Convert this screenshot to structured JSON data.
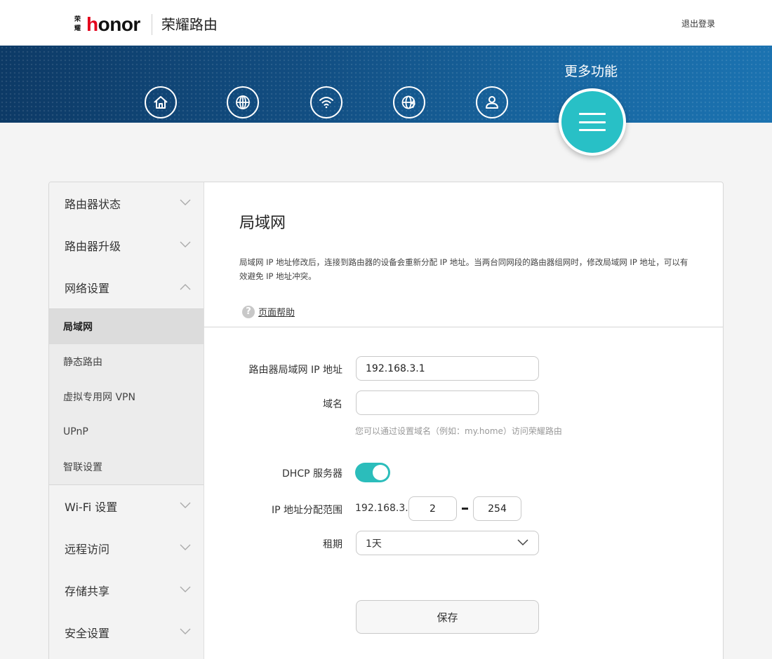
{
  "header": {
    "logo_small_top": "荣",
    "logo_small_bottom": "耀",
    "logo_brand_h": "h",
    "logo_brand_rest": "onor",
    "product_title": "荣耀路由",
    "logout_label": "退出登录"
  },
  "banner": {
    "nav_icons": [
      "home-icon",
      "globe-icon",
      "wifi-icon",
      "internet-settings-icon",
      "user-icon"
    ],
    "more_label": "更多功能"
  },
  "sidebar": {
    "router_status": "路由器状态",
    "router_upgrade": "路由器升级",
    "network_settings": "网络设置",
    "sub_items": [
      "局域网",
      "静态路由",
      "虚拟专用网 VPN",
      "UPnP",
      "智联设置"
    ],
    "wifi_settings": "Wi-Fi 设置",
    "remote_access": "远程访问",
    "storage_share": "存储共享",
    "security_settings": "安全设置"
  },
  "content": {
    "title": "局域网",
    "description": "局域网 IP 地址修改后，连接到路由器的设备会重新分配 IP 地址。当两台同网段的路由器组网时，修改局域网 IP 地址，可以有效避免 IP 地址冲突。",
    "help_label": "页面帮助",
    "form": {
      "lan_ip_label": "路由器局域网 IP 地址",
      "lan_ip_value": "192.168.3.1",
      "domain_label": "域名",
      "domain_value": "",
      "domain_hint": "您可以通过设置域名（例如：my.home）访问荣耀路由",
      "dhcp_label": "DHCP 服务器",
      "dhcp_enabled": true,
      "range_label": "IP 地址分配范围",
      "range_prefix": "192.168.3.",
      "range_start": "2",
      "range_end": "254",
      "lease_label": "租期",
      "lease_value": "1天",
      "save_label": "保存"
    }
  },
  "colors": {
    "accent": "#28c0c6",
    "banner_dark": "#0d3a66",
    "banner_light": "#1b72b0",
    "brand_red": "#e3001b"
  }
}
